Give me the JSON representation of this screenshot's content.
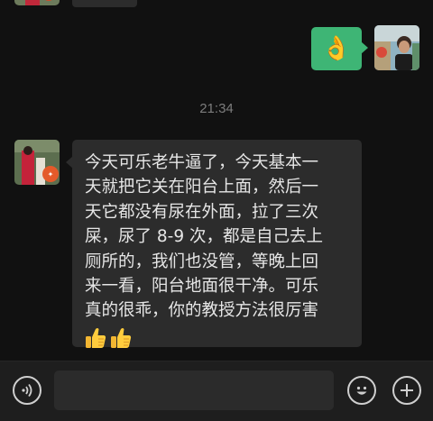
{
  "chat": {
    "timestamp": "21:34",
    "self_message": {
      "emoji": "👌",
      "emoji_name": "ok-hand"
    },
    "peer_message": {
      "lines": [
        "今天可乐老牛逼了，今天基本一",
        "天就把它关在阳台上面，然后一",
        "天它都没有尿在外面，拉了三次",
        "屎，尿了 8-9 次，都是自己去上",
        "厕所的，我们也没管，等晚上回",
        "来一看，阳台地面很干净。可乐",
        "真的很乖，你的教授方法很厉害"
      ],
      "trailing_emojis": [
        "thumbs-up-icon",
        "thumbs-up-icon"
      ]
    }
  },
  "input_bar": {
    "input_value": "",
    "voice_icon": "voice-icon",
    "emoji_icon": "smiley-icon",
    "plus_icon": "plus-icon"
  },
  "colors": {
    "background": "#111111",
    "self_bubble": "#3eb575",
    "peer_bubble": "#2c2c2c",
    "input_bar": "#1e1e1e"
  }
}
